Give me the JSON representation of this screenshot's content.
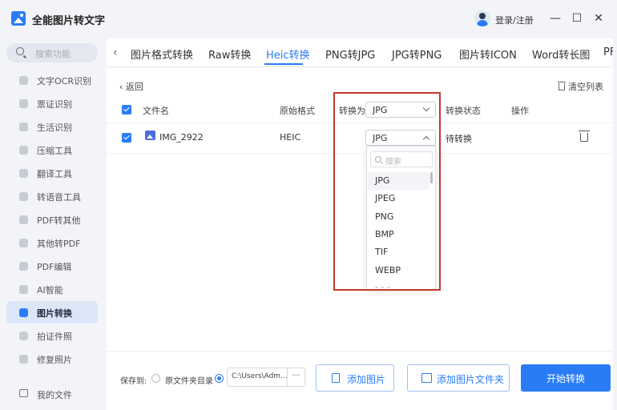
{
  "app": {
    "title": "全能图片转文字",
    "login": "登录/注册"
  },
  "window": {
    "minimize": "—",
    "maximize": "☐",
    "close": "✕"
  },
  "sidebar": {
    "search_placeholder": "搜索功能",
    "items": [
      {
        "label": "文字OCR识别"
      },
      {
        "label": "票证识别"
      },
      {
        "label": "生活识别"
      },
      {
        "label": "压缩工具"
      },
      {
        "label": "翻译工具"
      },
      {
        "label": "转语音工具"
      },
      {
        "label": "PDF转其他"
      },
      {
        "label": "其他转PDF"
      },
      {
        "label": "PDF编辑"
      },
      {
        "label": "AI智能"
      },
      {
        "label": "图片转换"
      },
      {
        "label": "拍证件照"
      },
      {
        "label": "修复照片"
      }
    ],
    "active_index": 10,
    "my_files": "我的文件"
  },
  "tabs": {
    "items": [
      "图片格式转换",
      "Raw转换",
      "Heic转换",
      "PNG转JPG",
      "JPG转PNG",
      "图片转ICON",
      "Word转长图",
      "PF"
    ],
    "active": "Heic转换"
  },
  "toolbar": {
    "back": "返回",
    "clear_list": "清空列表"
  },
  "table": {
    "headers": {
      "filename": "文件名",
      "original_format": "原始格式",
      "convert_to": "转换为",
      "status": "转换状态",
      "action": "操作"
    },
    "global_target": "JPG",
    "rows": [
      {
        "filename": "IMG_2922",
        "original_format": "HEIC",
        "target": "JPG",
        "status": "待转换"
      }
    ]
  },
  "dropdown": {
    "search_placeholder": "搜索",
    "options": [
      "JPG",
      "JPEG",
      "PNG",
      "BMP",
      "TIF",
      "WEBP"
    ],
    "truncated_hint": "- - -"
  },
  "bottom": {
    "save_to": "保存到:",
    "option_original": "原文件夹目录",
    "path": "C:\\Users\\Adm...",
    "browse": "···",
    "add_image": "添加图片",
    "add_folder": "添加图片文件夹",
    "start": "开始转换"
  },
  "colors": {
    "accent": "#2a7cf6",
    "highlight": "#c0392b"
  }
}
